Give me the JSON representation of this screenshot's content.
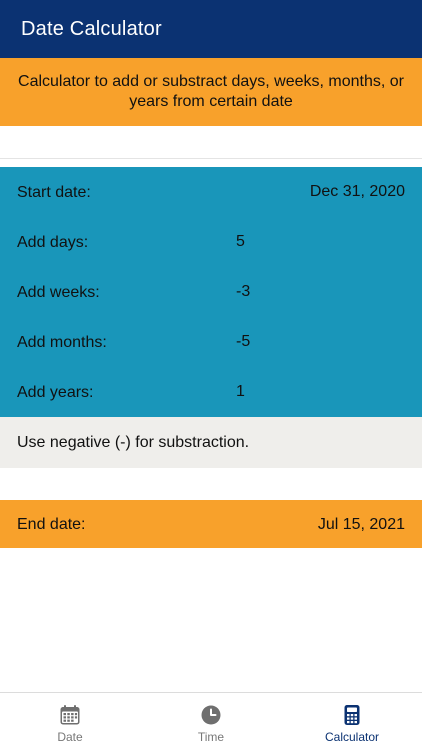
{
  "header": {
    "title": "Date Calculator"
  },
  "intro": {
    "text": "Calculator to add or substract days, weeks, months, or years from certain date"
  },
  "form": {
    "start_date": {
      "label": "Start date:",
      "value": "Dec 31, 2020"
    },
    "rows": [
      {
        "label": "Add days:",
        "value": "5"
      },
      {
        "label": "Add weeks:",
        "value": "-3"
      },
      {
        "label": "Add months:",
        "value": "-5"
      },
      {
        "label": "Add years:",
        "value": "1"
      }
    ],
    "note": "Use negative (-) for substraction."
  },
  "result": {
    "label": "End date:",
    "value": "Jul 15, 2021"
  },
  "tabbar": {
    "items": [
      {
        "label": "Date",
        "icon": "calendar-icon",
        "active": false
      },
      {
        "label": "Time",
        "icon": "clock-icon",
        "active": false
      },
      {
        "label": "Calculator",
        "icon": "calculator-icon",
        "active": true
      }
    ]
  },
  "colors": {
    "header_bg": "#0b3272",
    "accent_orange": "#f8a12b",
    "input_blue": "#1996ba",
    "note_bg": "#efeeeb",
    "tab_active": "#0b3272",
    "tab_inactive": "#777777"
  }
}
